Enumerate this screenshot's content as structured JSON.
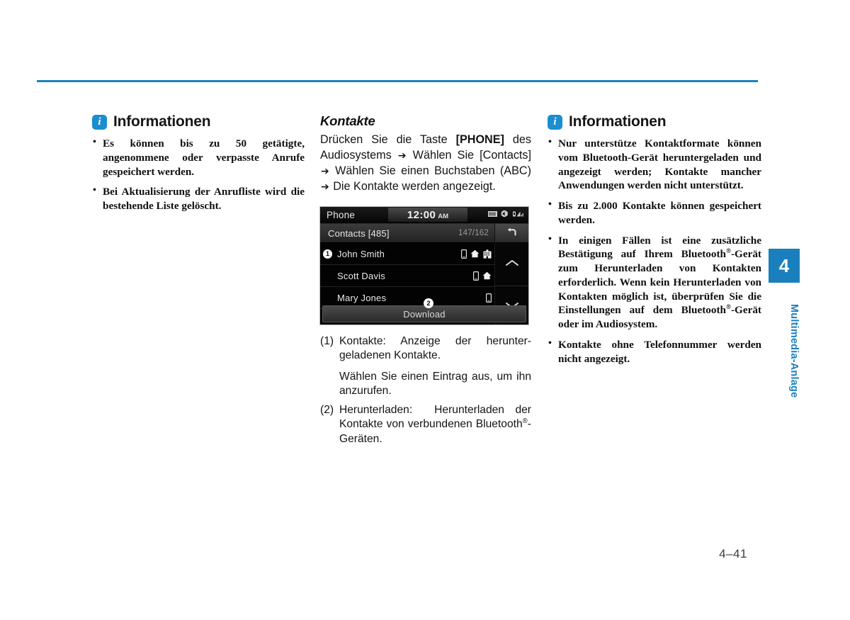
{
  "page": {
    "number": "4–41",
    "chapter_tab": "4",
    "chapter_label": "Multimedia-Anlage",
    "accent_color": "#1a80bd"
  },
  "left_column": {
    "info_icon": "info-icon",
    "title": "Informationen",
    "bullets": [
      "Es können bis zu 50 getätigte, angenommene oder verpasste Anrufe gespeichert werden.",
      "Bei Aktualisierung der Anrufliste wird die bestehende Liste gelöscht."
    ]
  },
  "mid_column": {
    "heading": "Kontakte",
    "intro_parts": {
      "p1": "Drücken Sie die Taste ",
      "b1": "[PHONE]",
      "p2": " des Audiosystems ",
      "a1": "➔",
      "p3": " Wählen Sie [Contacts] ",
      "a2": "➔",
      "p4": " Wählen Sie einen Buchstaben (ABC) ",
      "a3": "➔",
      "p5": " Die Kontakte werden angezeigt."
    },
    "captions": [
      {
        "num": "(1)",
        "text": "Kontakte: Anzeige der herunter-geladenen Kontakte.",
        "sub": "Wählen Sie einen Eintrag aus, um ihn anzurufen."
      },
      {
        "num": "(2)",
        "text": "Herunterladen:  Herunterladen der Kontakte von verbundenen Bluetooth®-Geräten.",
        "sub": ""
      }
    ]
  },
  "device_screenshot": {
    "status_bar": {
      "title": "Phone",
      "clock_time": "12:00",
      "clock_meridiem": "AM",
      "icons": [
        "sd-card-icon",
        "mute-audio-icon",
        "signal-bars-icon"
      ]
    },
    "sub_bar": {
      "title": "Contacts [485]",
      "count": "147/162",
      "back_icon": "back-arrow-icon"
    },
    "contacts": [
      {
        "marker": "1",
        "name": "John Smith",
        "icons": [
          "mobile-icon",
          "home-icon",
          "office-icon"
        ]
      },
      {
        "marker": "",
        "name": "Scott Davis",
        "icons": [
          "mobile-icon",
          "home-icon"
        ]
      },
      {
        "marker": "",
        "name": "Mary Jones",
        "icons": [
          "mobile-icon"
        ]
      }
    ],
    "scroll": {
      "up_icon": "chevron-up-icon",
      "down_icon": "chevron-down-icon"
    },
    "download_button": "Download",
    "download_callout": "2"
  },
  "right_column": {
    "info_icon": "info-icon",
    "title": "Informationen",
    "bullets": [
      {
        "pre": "Nur unterstütze Kontaktformate können vom Bluetooth-Gerät heruntergeladen und angezeigt werden; Kontakte mancher Anwendungen werden nicht unterstützt.",
        "reg": false
      },
      {
        "pre": "Bis zu 2.000 Kontakte können gespeichert werden.",
        "reg": false
      },
      {
        "pre": "In einigen Fällen ist eine zusätzliche Bestätigung auf Ihrem Bluetooth®-Gerät zum Herunterladen von Kontakten erforderlich. Wenn kein Herunterladen von Kontakten möglich ist, überprüfen Sie die Einstellungen auf dem Bluetooth®-Gerät oder im Audiosystem.",
        "reg": true
      },
      {
        "pre": "Kontakte ohne Telefonnummer werden nicht angezeigt.",
        "reg": false
      }
    ]
  }
}
